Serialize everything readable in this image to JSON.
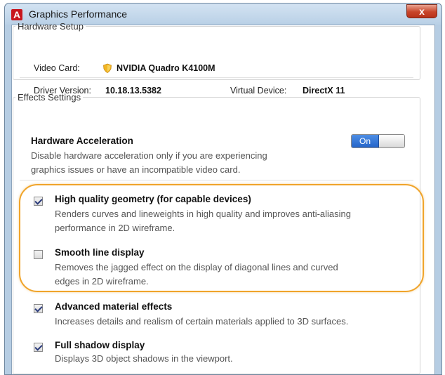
{
  "window": {
    "title": "Graphics Performance",
    "app_icon_letter": "A",
    "close_label": "x"
  },
  "hardware_setup": {
    "legend": "Hardware Setup",
    "video_card_label": "Video Card:",
    "video_card_value": "NVIDIA Quadro K4100M",
    "driver_version_label": "Driver Version:",
    "driver_version_value": "10.18.13.5382",
    "virtual_device_label": "Virtual Device:",
    "virtual_device_value": "DirectX 11"
  },
  "effects_settings": {
    "legend": "Effects Settings",
    "hardware_acceleration": {
      "title": "Hardware Acceleration",
      "description_line1": "Disable hardware acceleration only if you are experiencing",
      "description_line2": "graphics issues or have an incompatible video card.",
      "toggle_label": "On",
      "toggle_state": "on"
    },
    "options": [
      {
        "title": "High quality geometry (for capable devices)",
        "description_line1": "Renders curves and lineweights in high quality and improves anti-aliasing",
        "description_line2": "performance in 2D wireframe.",
        "checked": true
      },
      {
        "title": "Smooth line display",
        "description_line1": "Removes the jagged effect on the display of diagonal lines and curved",
        "description_line2": "edges in 2D wireframe.",
        "checked": false
      },
      {
        "title": "Advanced material effects",
        "description_line1": "Increases details and realism of certain materials applied to 3D surfaces.",
        "checked": true
      },
      {
        "title": "Full shadow display",
        "description_line1": "Displays 3D object shadows in the viewport.",
        "checked": true
      }
    ]
  },
  "colors": {
    "highlight_outline": "#f0a42a",
    "toggle_on": "#2f6fd6",
    "close_button": "#c8452a"
  }
}
